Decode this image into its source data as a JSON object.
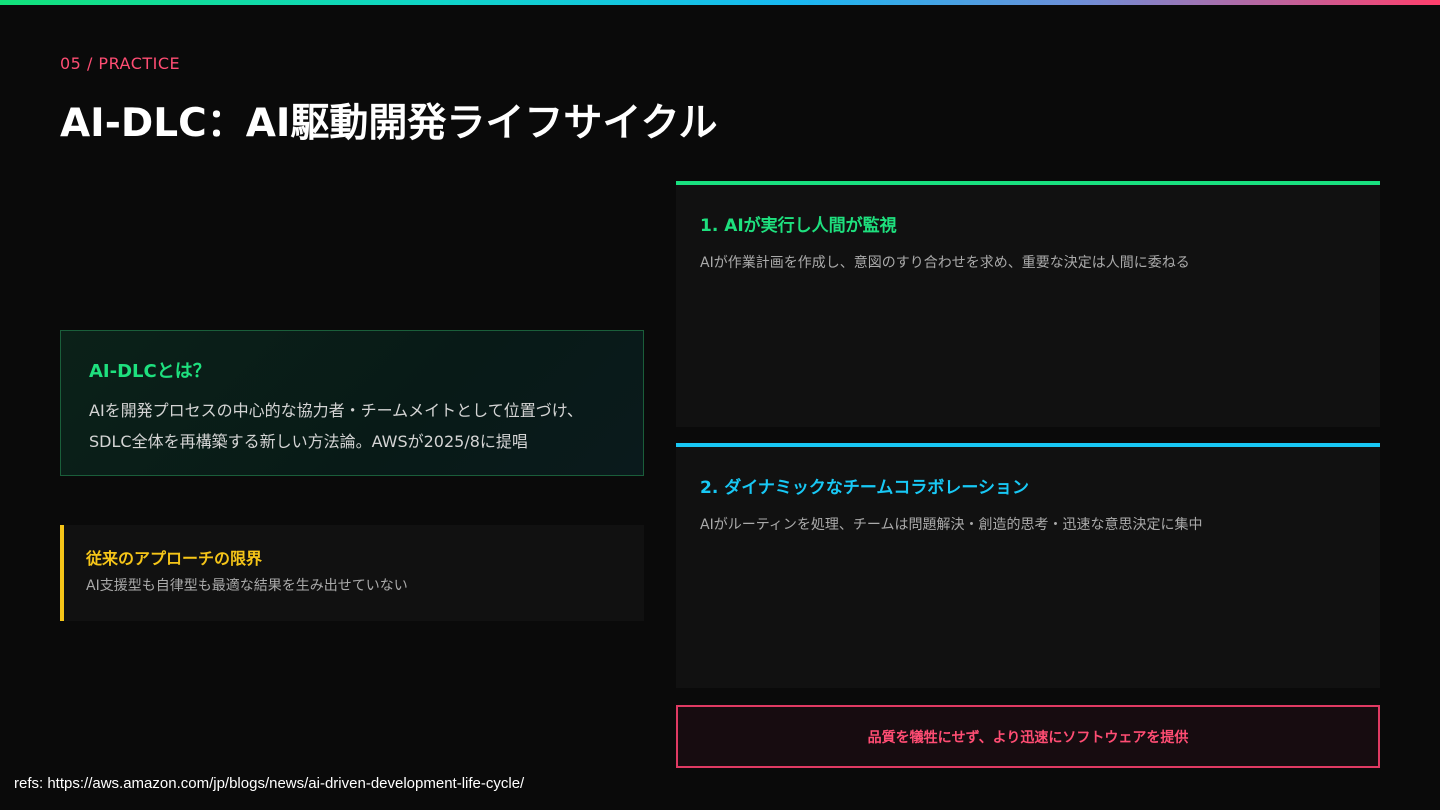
{
  "header": {
    "section_label": "05 / PRACTICE",
    "title": "AI-DLC：AI駆動開発ライフサイクル"
  },
  "about": {
    "title": "AI-DLCとは？",
    "body": "AIを開発プロセスの中心的な協力者・チームメイトとして位置づけ、SDLC全体を再構築する新しい方法論。AWSが2025/8に提唱"
  },
  "limitations": {
    "title": "従来のアプローチの限界",
    "body": "AI支援型も自律型も最適な結果を生み出せていない"
  },
  "features": [
    {
      "title": "1. AIが実行し人間が監視",
      "body": "AIが作業計画を作成し、意図のすり合わせを求め、重要な決定は人間に委ねる"
    },
    {
      "title": "2. ダイナミックなチームコラボレーション",
      "body": "AIがルーティンを処理、チームは問題解決・創造的思考・迅速な意思決定に集中"
    }
  ],
  "tagline": "品質を犠牲にせず、より迅速にソフトウェアを提供",
  "refs": "refs: https://aws.amazon.com/jp/blogs/news/ai-driven-development-life-cycle/",
  "colors": {
    "accent_green": "#1ee07e",
    "accent_cyan": "#18c8f5",
    "accent_pink": "#ff4d73",
    "accent_yellow": "#f5c518",
    "background": "#0a0a0a"
  }
}
